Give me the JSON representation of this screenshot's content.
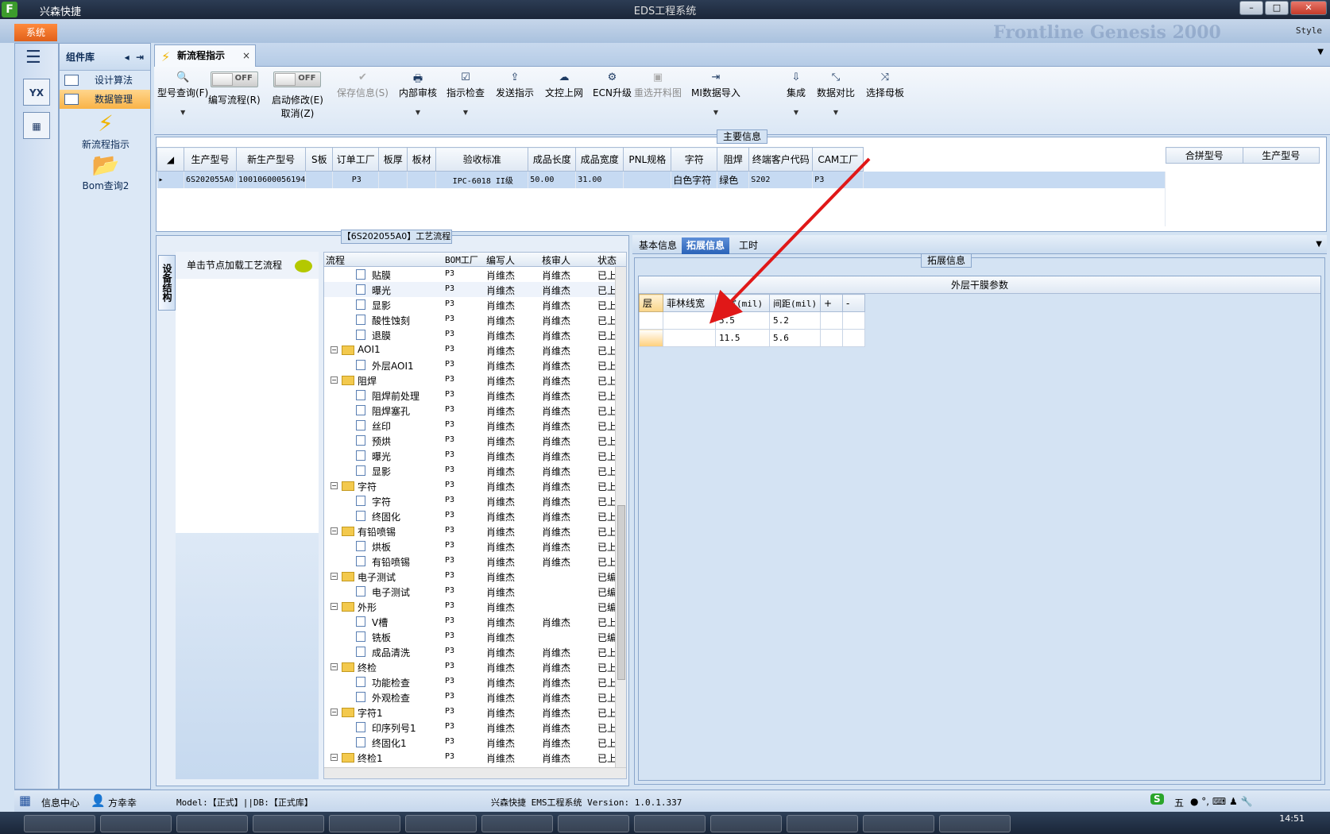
{
  "window": {
    "app_name": "兴森快捷",
    "title": "EDS工程系统",
    "logo": "F"
  },
  "ribbon": {
    "system_btn": "系统",
    "style_label": "Style",
    "faded_text": "Frontline Genesis 2000"
  },
  "leftbar": {
    "icon1": "YX",
    "icon2": "▦"
  },
  "complib": {
    "title": "组件库",
    "items": [
      {
        "label": "设计算法"
      },
      {
        "label": "数据管理"
      }
    ],
    "tools": [
      {
        "label": "新流程指示"
      },
      {
        "label": "Bom查询2"
      }
    ]
  },
  "tab": {
    "label": "新流程指示",
    "close": "×"
  },
  "toolbar": {
    "items": [
      {
        "label": "型号查询(F)",
        "glyph": "🔍"
      },
      {
        "label": "编写流程(R)",
        "toggle": "OFF"
      },
      {
        "label": "启动修改(E)",
        "sub": "取消(Z)",
        "toggle": "OFF"
      },
      {
        "label": "保存信息(S)",
        "glyph": "✔"
      },
      {
        "label": "内部审核",
        "glyph": "🖶"
      },
      {
        "label": "指示检查",
        "glyph": "☑"
      },
      {
        "label": "发送指示",
        "glyph": "⇪"
      },
      {
        "label": "文控上网",
        "glyph": "☁"
      },
      {
        "label": "ECN升级",
        "glyph": "⚙"
      },
      {
        "label": "重选开料图",
        "glyph": "▣"
      },
      {
        "label": "MI数据导入",
        "glyph": "⇥"
      },
      {
        "label": "集成",
        "glyph": "⇩"
      },
      {
        "label": "数据对比",
        "glyph": "⤡"
      },
      {
        "label": "选择母板",
        "glyph": "⤨"
      }
    ]
  },
  "main_info": {
    "title": "主要信息",
    "columns": [
      "生产型号",
      "新生产型号",
      "S板",
      "订单工厂",
      "板厚",
      "板材",
      "验收标准",
      "成品长度",
      "成品宽度",
      "PNL规格",
      "字符",
      "阻焊",
      "终端客户代码",
      "CAM工厂"
    ],
    "row": [
      "6S202055A0",
      "10010600056194",
      "",
      "P3",
      "",
      "",
      "IPC-6018 II级",
      "50.00",
      "31.00",
      "",
      "白色字符",
      "绿色",
      "S202",
      "P3"
    ],
    "side_columns": [
      "合拼型号",
      "生产型号"
    ]
  },
  "process": {
    "title": "【6S202055A0】工艺流程",
    "vtab": "设备结构",
    "note": "单击节点加载工艺流程",
    "columns": [
      "流程",
      "BOM工厂",
      "编写人",
      "核审人",
      "状态"
    ],
    "rows": [
      {
        "name": "贴膜",
        "level": 2,
        "factory": "P3",
        "writer": "肖维杰",
        "reviewer": "肖维杰",
        "status": "已上网"
      },
      {
        "name": "曝光",
        "level": 2,
        "factory": "P3",
        "writer": "肖维杰",
        "reviewer": "肖维杰",
        "status": "已上网"
      },
      {
        "name": "显影",
        "level": 2,
        "factory": "P3",
        "writer": "肖维杰",
        "reviewer": "肖维杰",
        "status": "已上网"
      },
      {
        "name": "酸性蚀刻",
        "level": 2,
        "factory": "P3",
        "writer": "肖维杰",
        "reviewer": "肖维杰",
        "status": "已上网"
      },
      {
        "name": "退膜",
        "level": 2,
        "factory": "P3",
        "writer": "肖维杰",
        "reviewer": "肖维杰",
        "status": "已上网"
      },
      {
        "name": "AOI1",
        "level": 1,
        "factory": "P3",
        "writer": "肖维杰",
        "reviewer": "肖维杰",
        "status": "已上网"
      },
      {
        "name": "外层AOI1",
        "level": 2,
        "factory": "P3",
        "writer": "肖维杰",
        "reviewer": "肖维杰",
        "status": "已上网"
      },
      {
        "name": "阻焊",
        "level": 1,
        "factory": "P3",
        "writer": "肖维杰",
        "reviewer": "肖维杰",
        "status": "已上网"
      },
      {
        "name": "阻焊前处理",
        "level": 2,
        "factory": "P3",
        "writer": "肖维杰",
        "reviewer": "肖维杰",
        "status": "已上网"
      },
      {
        "name": "阻焊塞孔",
        "level": 2,
        "factory": "P3",
        "writer": "肖维杰",
        "reviewer": "肖维杰",
        "status": "已上网"
      },
      {
        "name": "丝印",
        "level": 2,
        "factory": "P3",
        "writer": "肖维杰",
        "reviewer": "肖维杰",
        "status": "已上网"
      },
      {
        "name": "预烘",
        "level": 2,
        "factory": "P3",
        "writer": "肖维杰",
        "reviewer": "肖维杰",
        "status": "已上网"
      },
      {
        "name": "曝光",
        "level": 2,
        "factory": "P3",
        "writer": "肖维杰",
        "reviewer": "肖维杰",
        "status": "已上网"
      },
      {
        "name": "显影",
        "level": 2,
        "factory": "P3",
        "writer": "肖维杰",
        "reviewer": "肖维杰",
        "status": "已上网"
      },
      {
        "name": "字符",
        "level": 1,
        "factory": "P3",
        "writer": "肖维杰",
        "reviewer": "肖维杰",
        "status": "已上网"
      },
      {
        "name": "字符",
        "level": 2,
        "factory": "P3",
        "writer": "肖维杰",
        "reviewer": "肖维杰",
        "status": "已上网"
      },
      {
        "name": "终固化",
        "level": 2,
        "factory": "P3",
        "writer": "肖维杰",
        "reviewer": "肖维杰",
        "status": "已上网"
      },
      {
        "name": "有铅喷锡",
        "level": 1,
        "factory": "P3",
        "writer": "肖维杰",
        "reviewer": "肖维杰",
        "status": "已上网"
      },
      {
        "name": "烘板",
        "level": 2,
        "factory": "P3",
        "writer": "肖维杰",
        "reviewer": "肖维杰",
        "status": "已上网"
      },
      {
        "name": "有铅喷锡",
        "level": 2,
        "factory": "P3",
        "writer": "肖维杰",
        "reviewer": "肖维杰",
        "status": "已上网"
      },
      {
        "name": "电子测试",
        "level": 1,
        "factory": "P3",
        "writer": "肖维杰",
        "reviewer": "",
        "status": "已编写"
      },
      {
        "name": "电子测试",
        "level": 2,
        "factory": "P3",
        "writer": "肖维杰",
        "reviewer": "",
        "status": "已编写"
      },
      {
        "name": "外形",
        "level": 1,
        "factory": "P3",
        "writer": "肖维杰",
        "reviewer": "",
        "status": "已编写"
      },
      {
        "name": "V槽",
        "level": 2,
        "factory": "P3",
        "writer": "肖维杰",
        "reviewer": "肖维杰",
        "status": "已上网"
      },
      {
        "name": "铣板",
        "level": 2,
        "factory": "P3",
        "writer": "肖维杰",
        "reviewer": "",
        "status": "已编写"
      },
      {
        "name": "成品清洗",
        "level": 2,
        "factory": "P3",
        "writer": "肖维杰",
        "reviewer": "肖维杰",
        "status": "已上网"
      },
      {
        "name": "终检",
        "level": 1,
        "factory": "P3",
        "writer": "肖维杰",
        "reviewer": "肖维杰",
        "status": "已上网"
      },
      {
        "name": "功能检查",
        "level": 2,
        "factory": "P3",
        "writer": "肖维杰",
        "reviewer": "肖维杰",
        "status": "已上网"
      },
      {
        "name": "外观检查",
        "level": 2,
        "factory": "P3",
        "writer": "肖维杰",
        "reviewer": "肖维杰",
        "status": "已上网"
      },
      {
        "name": "字符1",
        "level": 1,
        "factory": "P3",
        "writer": "肖维杰",
        "reviewer": "肖维杰",
        "status": "已上网"
      },
      {
        "name": "印序列号1",
        "level": 2,
        "factory": "P3",
        "writer": "肖维杰",
        "reviewer": "肖维杰",
        "status": "已上网"
      },
      {
        "name": "终固化1",
        "level": 2,
        "factory": "P3",
        "writer": "肖维杰",
        "reviewer": "肖维杰",
        "status": "已上网"
      },
      {
        "name": "终检1",
        "level": 1,
        "factory": "P3",
        "writer": "肖维杰",
        "reviewer": "肖维杰",
        "status": "已上网"
      }
    ]
  },
  "right_tabs": [
    {
      "label": "基本信息"
    },
    {
      "label": "拓展信息"
    },
    {
      "label": "工时"
    }
  ],
  "ext": {
    "title": "拓展信息",
    "caption": "外层干膜参数",
    "columns": [
      "层",
      "菲林线宽",
      "线宽(mil)",
      "间距(mil)",
      "+",
      "-"
    ],
    "rows": [
      [
        "",
        "",
        "5.5",
        "5.2",
        "",
        ""
      ],
      [
        "",
        "",
        "11.5",
        "5.6",
        "",
        ""
      ]
    ]
  },
  "status": {
    "info_center": "信息中心",
    "user": "方幸幸",
    "model": "Model:【正式】||DB:【正式库】",
    "version": "兴森快捷 EMS工程系统 Version: 1.0.1.337",
    "ime": "五",
    "time": "14:51"
  },
  "colors": {
    "accent": "#2a63b8",
    "arrow": "#e01818",
    "selected_row": "#c6daf2"
  }
}
